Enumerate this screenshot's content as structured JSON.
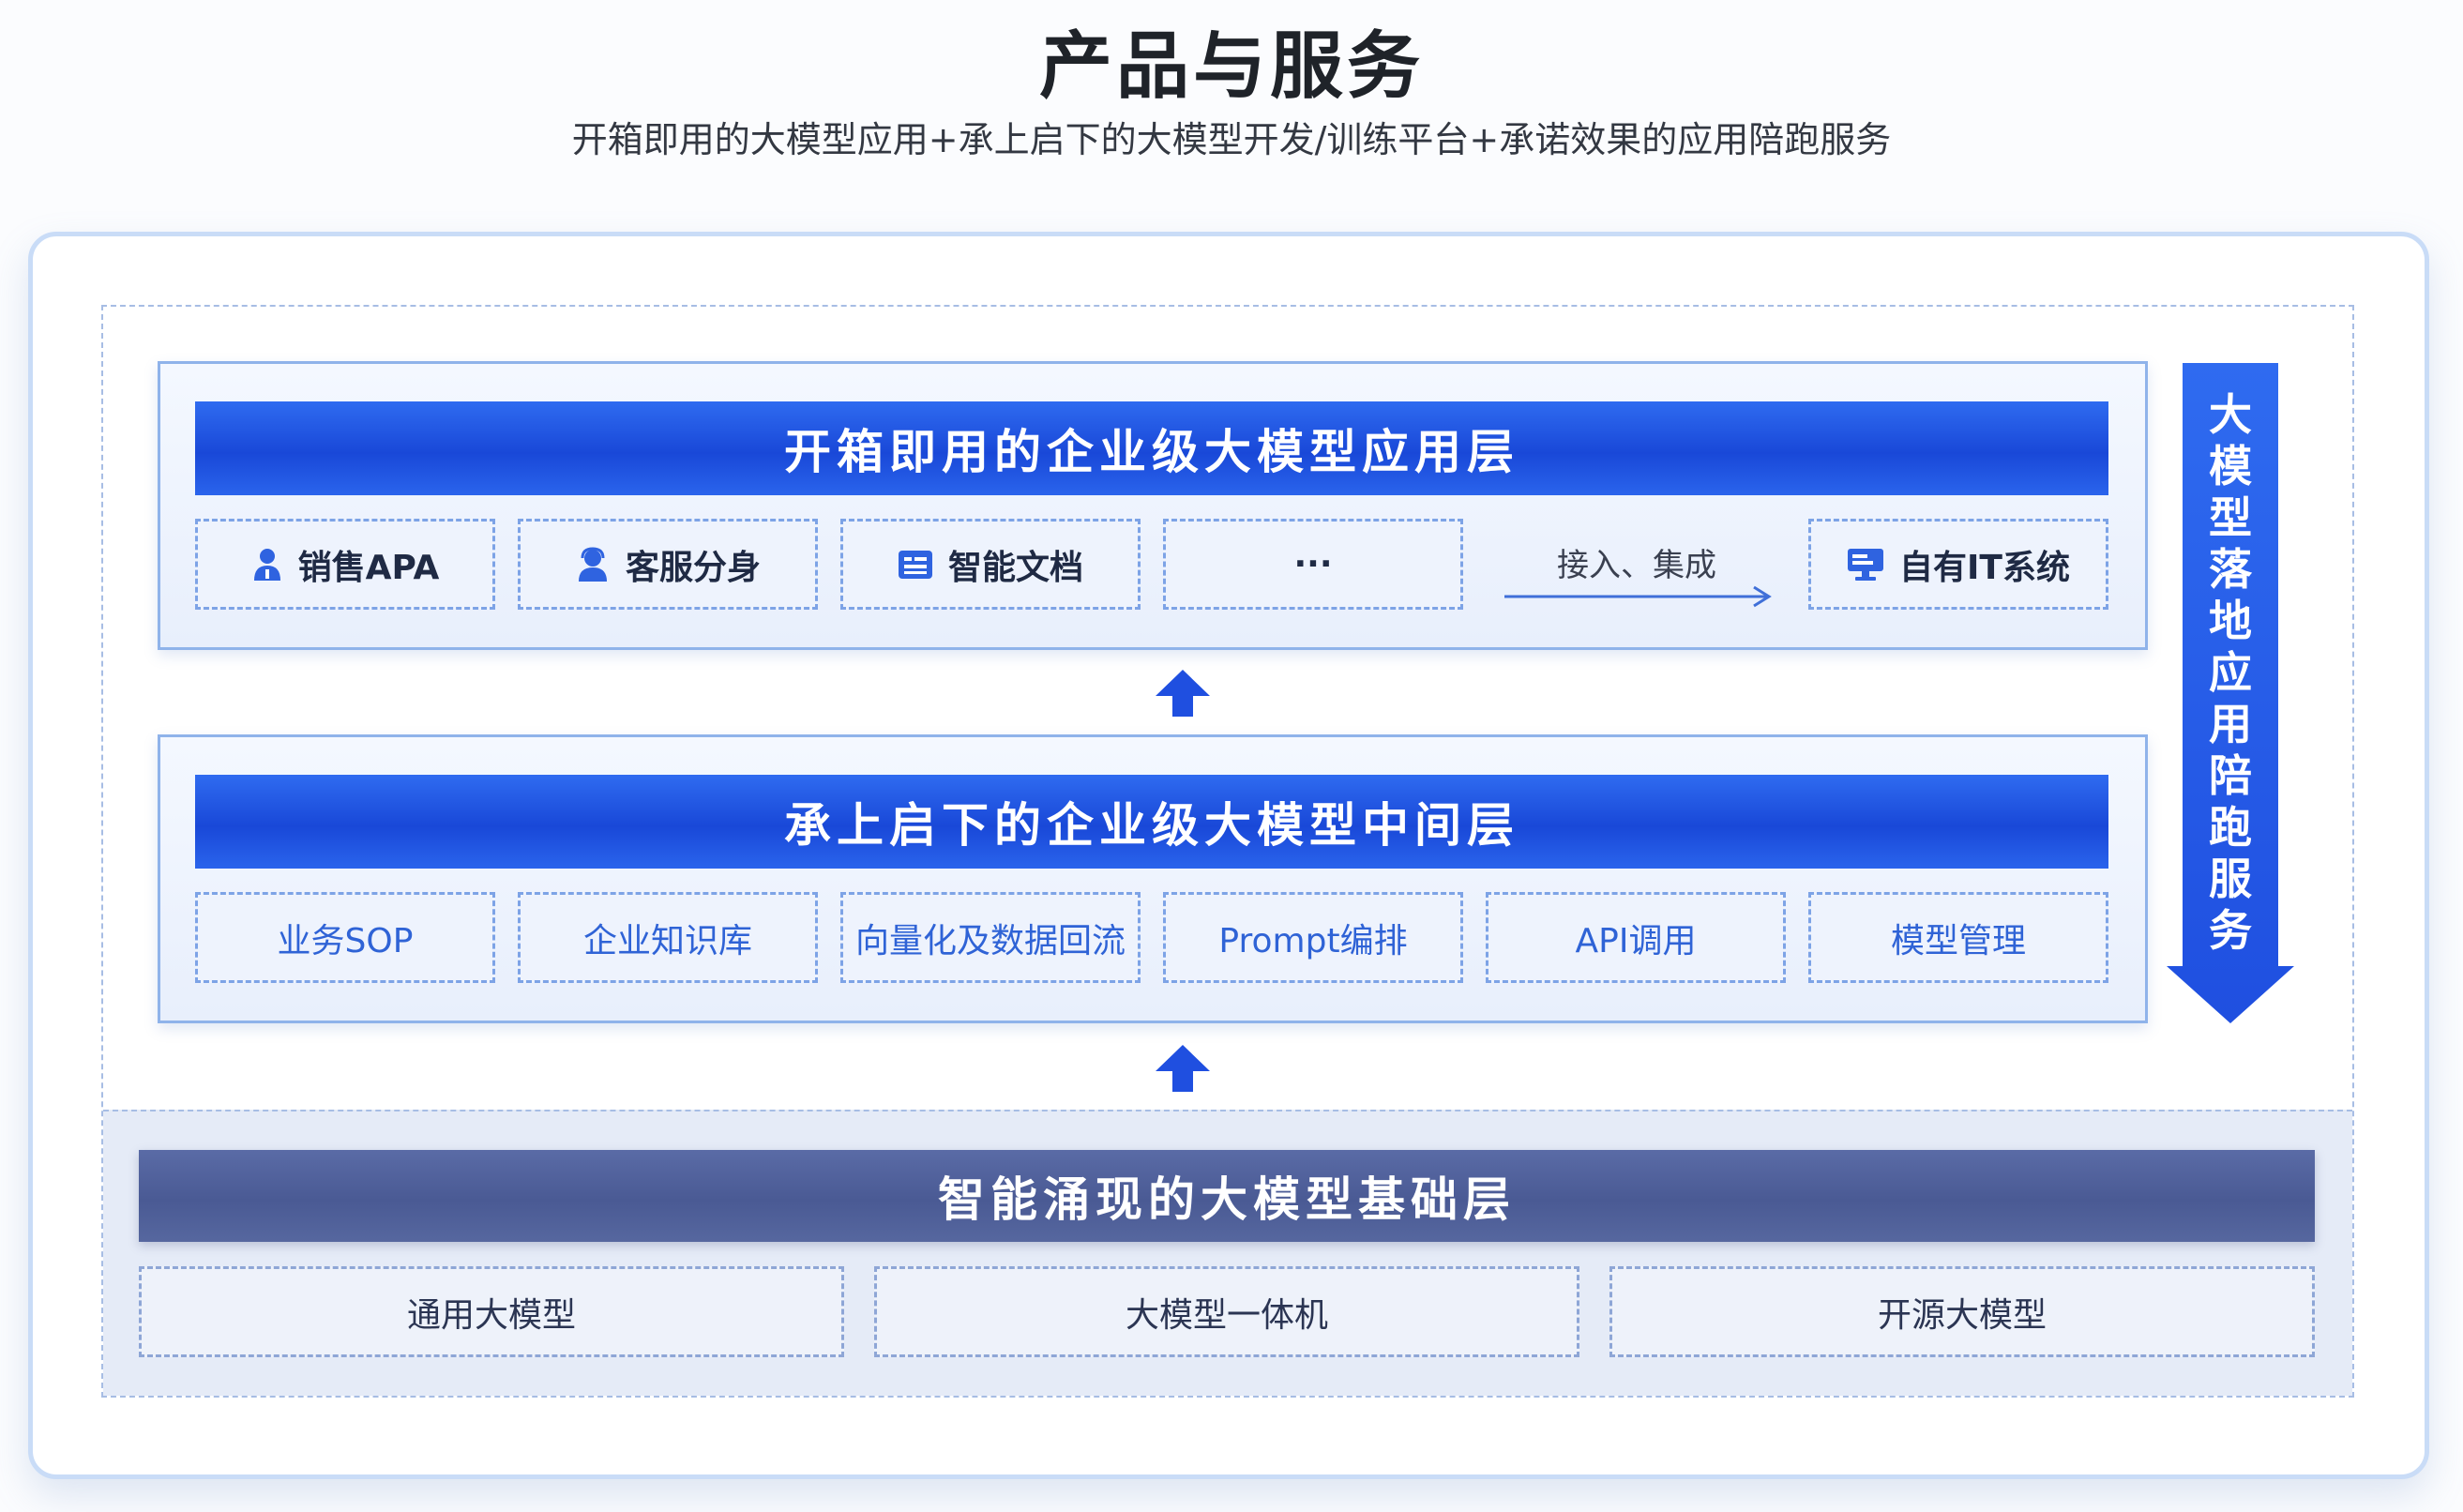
{
  "header": {
    "title": "产品与服务",
    "subtitle": "开箱即用的大模型应用+承上启下的大模型开发/训练平台+承诺效果的应用陪跑服务"
  },
  "app_layer": {
    "title": "开箱即用的企业级大模型应用层",
    "items": [
      {
        "label": "销售APA",
        "icon": "user-icon"
      },
      {
        "label": "客服分身",
        "icon": "agent-icon"
      },
      {
        "label": "智能文档",
        "icon": "document-icon"
      },
      {
        "label": "···"
      }
    ],
    "connector_label": "接入、集成",
    "it_system": {
      "label": "自有IT系统",
      "icon": "monitor-icon"
    }
  },
  "middle_layer": {
    "title": "承上启下的企业级大模型中间层",
    "items": [
      "业务SOP",
      "企业知识库",
      "向量化及数据回流",
      "Prompt编排",
      "API调用",
      "模型管理"
    ]
  },
  "base_layer": {
    "title": "智能涌现的大模型基础层",
    "items": [
      "通用大模型",
      "大模型一体机",
      "开源大模型"
    ]
  },
  "side": {
    "label": "大模型落地应用陪跑服务"
  },
  "colors": {
    "primary_blue": "#1f4fe0",
    "base_bar": "#4f5f99",
    "card_border": "#c9dcf7"
  }
}
